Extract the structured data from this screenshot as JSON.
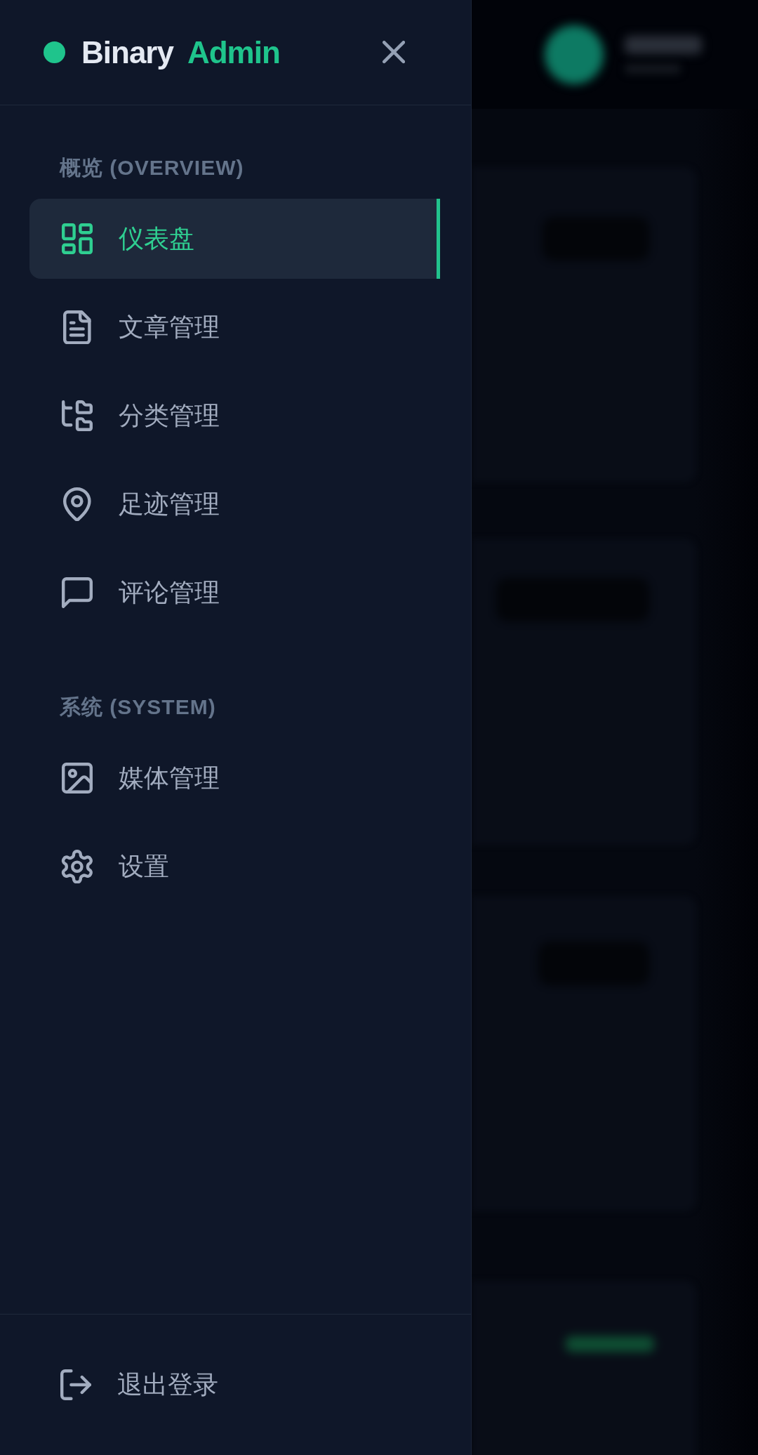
{
  "sidebar": {
    "logo": {
      "name": "Binary",
      "accent": "Admin"
    },
    "sections": [
      {
        "title": "概览 (OVERVIEW)",
        "items": [
          {
            "label": "仪表盘",
            "selected": true
          },
          {
            "label": "文章管理",
            "selected": false
          },
          {
            "label": "分类管理",
            "selected": false
          },
          {
            "label": "足迹管理",
            "selected": false
          },
          {
            "label": "评论管理",
            "selected": false
          }
        ]
      },
      {
        "title": "系统 (SYSTEM)",
        "items": [
          {
            "label": "媒体管理",
            "selected": false
          },
          {
            "label": "设置",
            "selected": false
          }
        ]
      }
    ],
    "footer": {
      "logout": "退出登录"
    }
  }
}
